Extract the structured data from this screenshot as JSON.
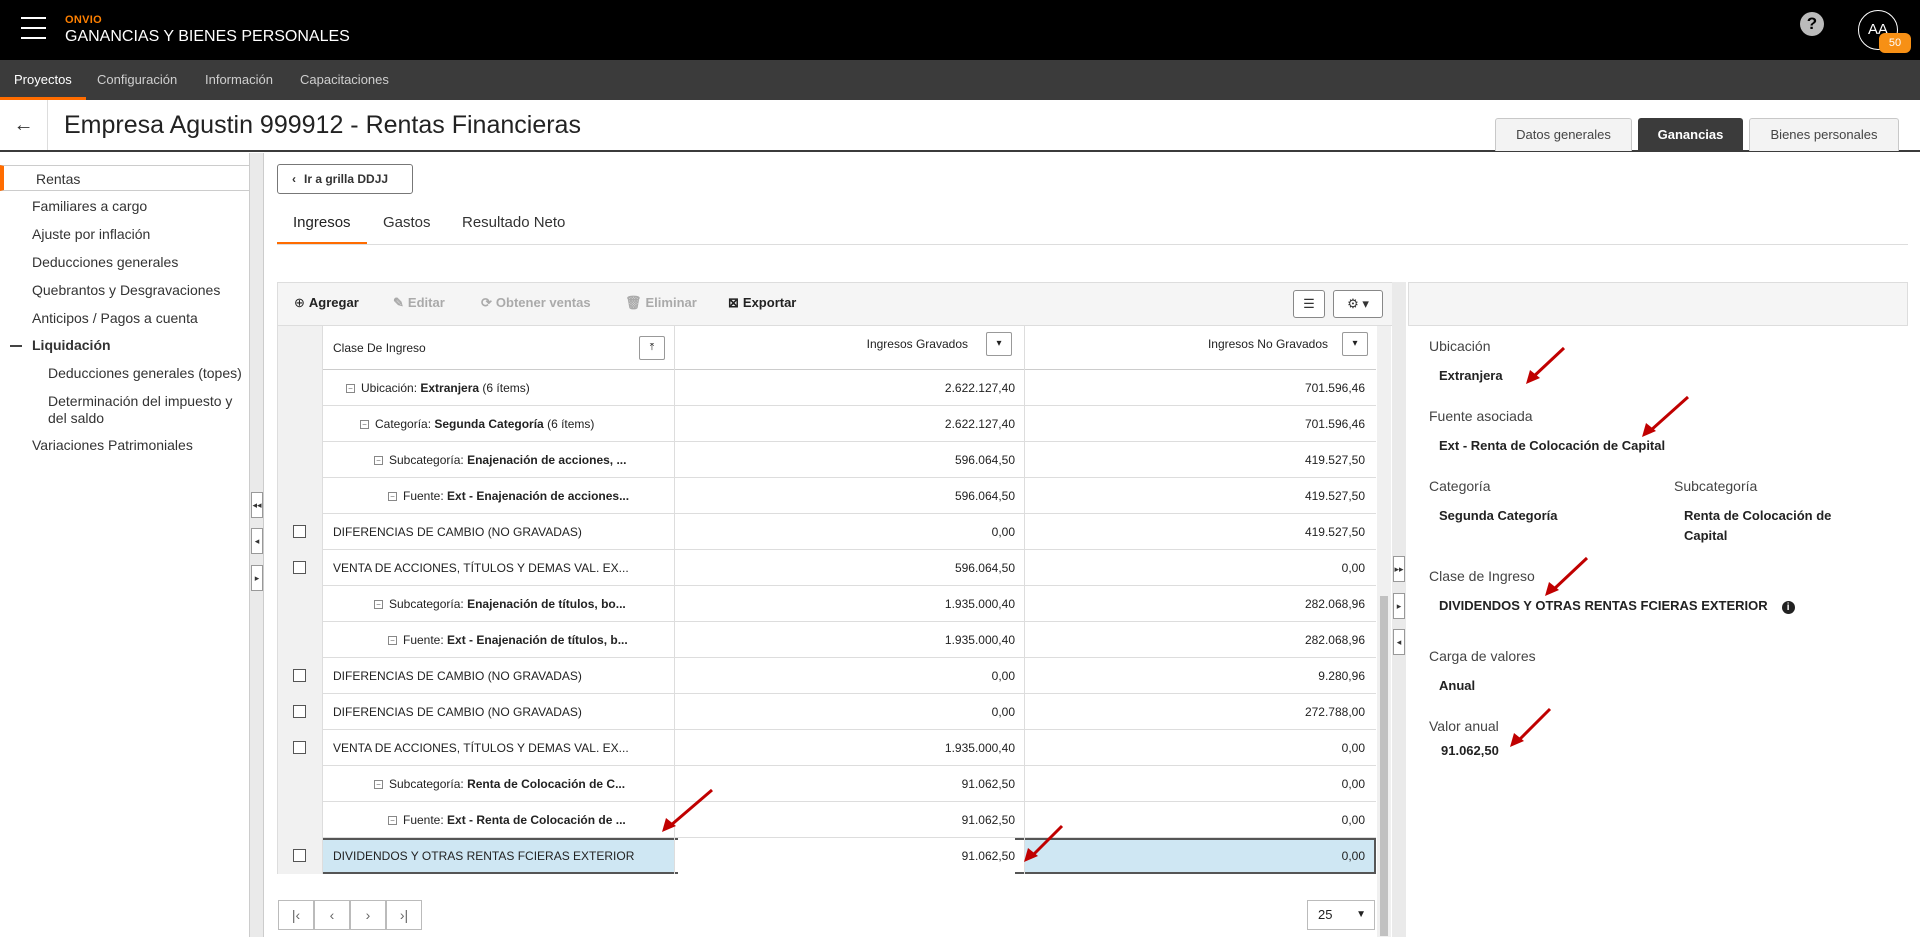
{
  "app": {
    "brand": "ONVIO",
    "title": "GANANCIAS Y BIENES PERSONALES",
    "avatar": "AA",
    "badge": "50",
    "help": "?"
  },
  "nav": [
    "Proyectos",
    "Configuración",
    "Información",
    "Capacitaciones"
  ],
  "page": {
    "title": "Empresa Agustin 999912 - Rentas Financieras",
    "back": "←",
    "tabs": [
      "Datos generales",
      "Ganancias",
      "Bienes personales"
    ]
  },
  "sidebar": {
    "items": [
      "Rentas",
      "Familiares a cargo",
      "Ajuste por inflación",
      "Deducciones generales",
      "Quebrantos y Desgravaciones",
      "Anticipos / Pagos a cuenta",
      "Liquidación",
      "Deducciones generales (topes)",
      "Determinación del impuesto y",
      "del saldo",
      "Variaciones Patrimoniales"
    ]
  },
  "main": {
    "back_button": "Ir a grilla DDJJ",
    "subtabs": [
      "Ingresos",
      "Gastos",
      "Resultado Neto"
    ],
    "toolbar": {
      "agregar": "Agregar",
      "editar": "Editar",
      "obtener": "Obtener ventas",
      "eliminar": "Eliminar",
      "exportar": "Exportar"
    },
    "grid": {
      "headers": [
        "Clase De Ingreso",
        "Ingresos Gravados",
        "Ingresos No Gravados"
      ],
      "rows": [
        {
          "pre": "Ubicación: ",
          "bold": "Extranjera",
          "post": " (6 ítems)",
          "g": "2.622.127,40",
          "ng": "701.596,46"
        },
        {
          "pre": "Categoría: ",
          "bold": "Segunda Categoría",
          "post": " (6 ítems)",
          "g": "2.622.127,40",
          "ng": "701.596,46"
        },
        {
          "pre": "Subcategoría: ",
          "bold": "Enajenación de acciones, ...",
          "post": "",
          "g": "596.064,50",
          "ng": "419.527,50"
        },
        {
          "pre": "Fuente: ",
          "bold": "Ext - Enajenación de acciones...",
          "post": "",
          "g": "596.064,50",
          "ng": "419.527,50"
        },
        {
          "text": "DIFERENCIAS DE CAMBIO (NO GRAVADAS)",
          "g": "0,00",
          "ng": "419.527,50"
        },
        {
          "text": "VENTA DE ACCIONES, TÍTULOS Y DEMAS VAL. EX...",
          "g": "596.064,50",
          "ng": "0,00"
        },
        {
          "pre": "Subcategoría: ",
          "bold": "Enajenación de títulos, bo...",
          "post": "",
          "g": "1.935.000,40",
          "ng": "282.068,96"
        },
        {
          "pre": "Fuente: ",
          "bold": "Ext - Enajenación de títulos, b...",
          "post": "",
          "g": "1.935.000,40",
          "ng": "282.068,96"
        },
        {
          "text": "DIFERENCIAS DE CAMBIO (NO GRAVADAS)",
          "g": "0,00",
          "ng": "9.280,96"
        },
        {
          "text": "DIFERENCIAS DE CAMBIO (NO GRAVADAS)",
          "g": "0,00",
          "ng": "272.788,00"
        },
        {
          "text": "VENTA DE ACCIONES, TÍTULOS Y DEMAS VAL. EX...",
          "g": "1.935.000,40",
          "ng": "0,00"
        },
        {
          "pre": "Subcategoría: ",
          "bold": "Renta de Colocación de C...",
          "post": "",
          "g": "91.062,50",
          "ng": "0,00"
        },
        {
          "pre": "Fuente: ",
          "bold": "Ext - Renta de Colocación de ...",
          "post": "",
          "g": "91.062,50",
          "ng": "0,00"
        },
        {
          "text": "DIVIDENDOS Y OTRAS RENTAS FCIERAS EXTERIOR",
          "g": "91.062,50",
          "ng": "0,00"
        }
      ]
    },
    "pager": {
      "size": "25"
    }
  },
  "detail": {
    "ubicacion_label": "Ubicación",
    "ubicacion": "Extranjera",
    "fuente_label": "Fuente asociada",
    "fuente": "Ext - Renta de Colocación de Capital",
    "categoria_label": "Categoría",
    "categoria": "Segunda Categoría",
    "subcategoria_label": "Subcategoría",
    "subcategoria_1": "Renta de Colocación de",
    "subcategoria_2": "Capital",
    "clase_label": "Clase de Ingreso",
    "clase": "DIVIDENDOS Y OTRAS RENTAS FCIERAS EXTERIOR",
    "carga_label": "Carga de valores",
    "carga": "Anual",
    "valor_label": "Valor anual",
    "valor": "91.062,50"
  },
  "colors": {
    "accent": "#ff6c00",
    "annotation": "#c00000",
    "selected": "#cfe7f3"
  }
}
